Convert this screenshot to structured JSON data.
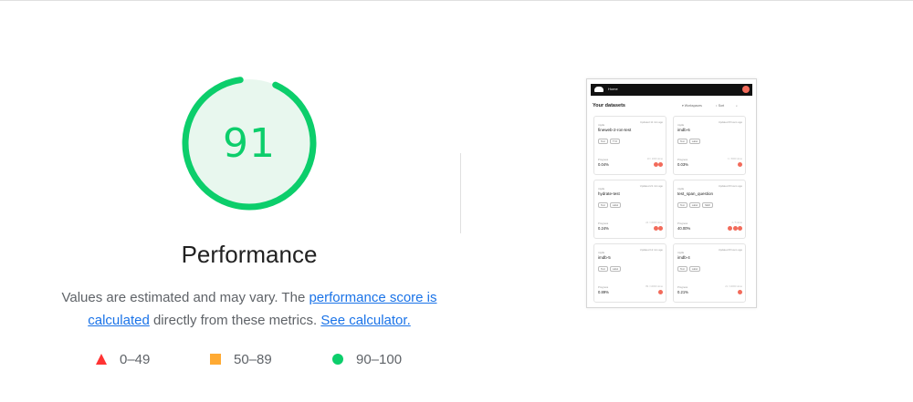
{
  "report": {
    "score": "91",
    "score_fraction": 0.91,
    "category_title": "Performance",
    "description_pre": "Values are estimated and may vary. The ",
    "description_link1": "performance score is calculated",
    "description_mid": " directly from these metrics. ",
    "description_link2": "See calculator.",
    "colors": {
      "pass": "#0cce6b",
      "average": "#ffaa33",
      "fail": "#ff3333",
      "pass_bg": "#e8f7ee"
    }
  },
  "legend": [
    {
      "icon": "red-triangle-icon",
      "label": "0–49"
    },
    {
      "icon": "orange-square-icon",
      "label": "50–89"
    },
    {
      "icon": "green-circle-icon",
      "label": "90–100"
    }
  ],
  "screenshot": {
    "header_label": "Home",
    "title": "Your datasets",
    "workspaces_label": "Workspaces",
    "sort_label": "Sort",
    "cards": [
      {
        "owner": "mytis",
        "name": "fineweb-2-ron-test",
        "meta": "Updated 11 min ago",
        "tags": [
          "Text",
          "TYO"
        ],
        "progress_label": "Progress",
        "progress": "0.04%",
        "right_text": "10 / 1000 done"
      },
      {
        "owner": "mytis",
        "name": "imdb-6",
        "meta": "Updated 8 hours ago",
        "tags": [
          "Text",
          "Label"
        ],
        "progress_label": "Progress",
        "progress": "0.03%",
        "right_text": "1 / 5000 done"
      },
      {
        "owner": "mytis",
        "name": "hydrate-test",
        "meta": "Updated 21 min ago",
        "tags": [
          "Text",
          "Label"
        ],
        "progress_label": "Progress",
        "progress": "0.24%",
        "right_text": "24 / 10000 done"
      },
      {
        "owner": "mytis",
        "name": "test_span_question",
        "meta": "Updated 8 hours ago",
        "tags": [
          "Text",
          "Label",
          "NER"
        ],
        "progress_label": "Progress",
        "progress": "40.00%",
        "right_text": "2 / 5 done"
      },
      {
        "owner": "mytis",
        "name": "imdb-5",
        "meta": "Updated 12 min ago",
        "tags": [
          "Text",
          "Label"
        ],
        "progress_label": "Progress",
        "progress": "0.89%",
        "right_text": "89 / 10000 done"
      },
      {
        "owner": "mytis",
        "name": "imdb-4",
        "meta": "Updated 8 hours ago",
        "tags": [
          "Text",
          "Label"
        ],
        "progress_label": "Progress",
        "progress": "0.21%",
        "right_text": "21 / 10000 done"
      }
    ]
  }
}
